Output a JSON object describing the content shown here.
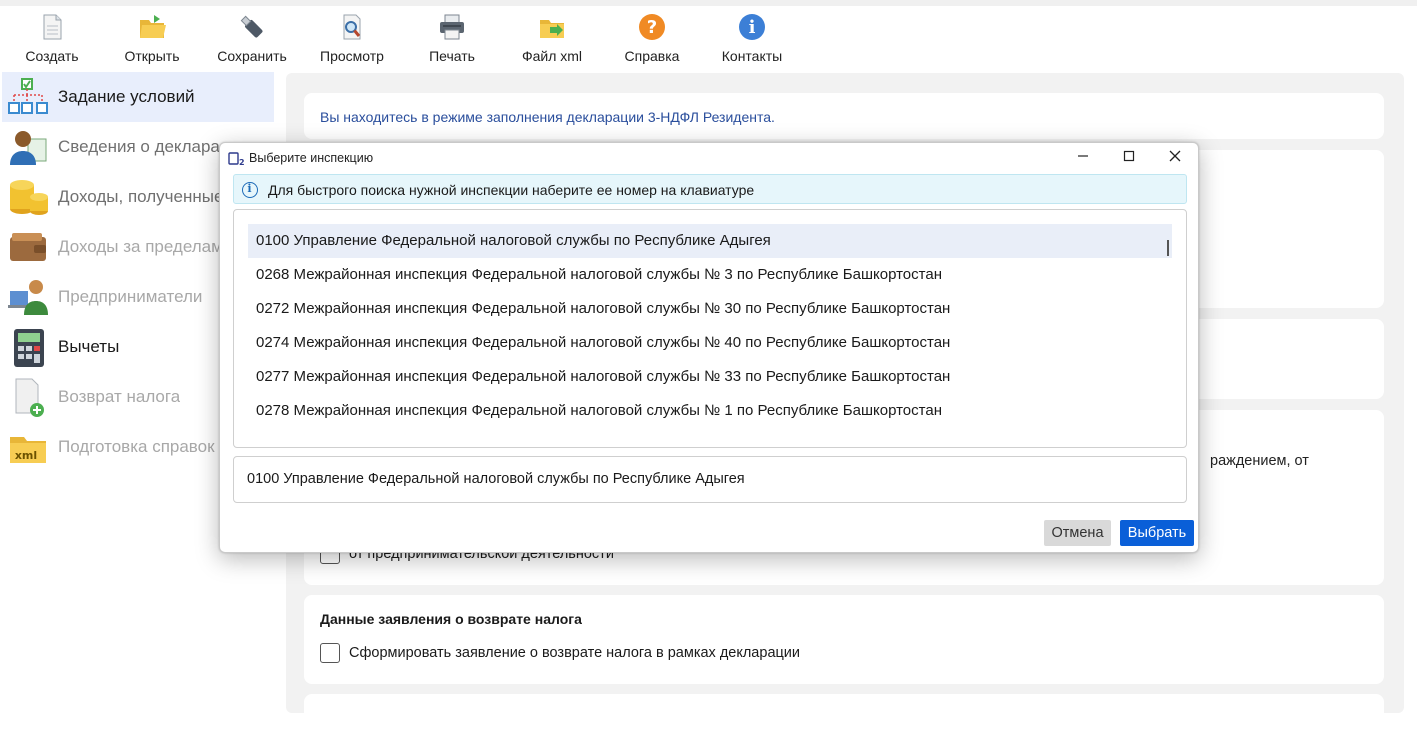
{
  "toolbar": {
    "items": [
      {
        "label": "Создать",
        "icon": "new-document-icon"
      },
      {
        "label": "Открыть",
        "icon": "open-folder-icon"
      },
      {
        "label": "Сохранить",
        "icon": "usb-drive-save-icon"
      },
      {
        "label": "Просмотр",
        "icon": "preview-magnifier-icon"
      },
      {
        "label": "Печать",
        "icon": "printer-icon"
      },
      {
        "label": "Файл xml",
        "icon": "xml-folder-icon"
      },
      {
        "label": "Справка",
        "icon": "help-question-icon"
      },
      {
        "label": "Контакты",
        "icon": "info-icon"
      }
    ]
  },
  "sidebar": {
    "items": [
      {
        "label": "Задание условий",
        "icon": "conditions-tree-icon",
        "state": "active"
      },
      {
        "label": "Сведения о деклара",
        "icon": "declarant-person-icon",
        "state": "partial"
      },
      {
        "label": "Доходы, полученные",
        "icon": "coins-stack-icon",
        "state": "partial"
      },
      {
        "label": "Доходы за пределам",
        "icon": "wallet-icon",
        "state": "disabled"
      },
      {
        "label": "Предприниматели",
        "icon": "entrepreneur-icon",
        "state": "disabled"
      },
      {
        "label": "Вычеты",
        "icon": "calculator-icon",
        "state": "normal"
      },
      {
        "label": "Возврат налога",
        "icon": "document-plus-icon",
        "state": "disabled"
      },
      {
        "label": "Подготовка справок",
        "icon": "xml-folder-icon",
        "state": "disabled"
      }
    ]
  },
  "main": {
    "mode_info": "Вы находитесь в режиме заполнения декларации 3-НДФЛ Резидента.",
    "fragment_right": "раждением, от",
    "fragment_checkbox": "от предпринимательской деятельности",
    "refund_title": "Данные заявления о возврате налога",
    "refund_checkbox": "Сформировать заявление о возврате налога в рамках декларации"
  },
  "dialog": {
    "title": "Выберите инспекцию",
    "hint": "Для быстрого поиска нужной инспекции наберите ее номер на клавиатуре",
    "inspections": [
      "0100 Управление Федеральной налоговой службы по Республике Адыгея",
      "0268 Межрайонная инспекция Федеральной налоговой службы № 3 по Республике Башкортостан",
      "0272 Межрайонная инспекция Федеральной налоговой службы № 30 по Республике Башкортостан",
      "0274 Межрайонная инспекция Федеральной налоговой службы № 40 по Республике Башкортостан",
      "0277 Межрайонная инспекция Федеральной налоговой службы № 33 по Республике Башкортостан",
      "0278 Межрайонная инспекция Федеральной налоговой службы № 1 по Республике Башкортостан"
    ],
    "selected_index": 0,
    "selected_value": "0100 Управление Федеральной налоговой службы по Республике Адыгея",
    "cancel_label": "Отмена",
    "ok_label": "Выбрать"
  },
  "colors": {
    "accent": "#0a5fd8",
    "info_text": "#2a4e9c",
    "hint_bg": "#e6f6fb",
    "selected_row": "#e9eef8",
    "panel_bg": "#f2f2f2"
  }
}
